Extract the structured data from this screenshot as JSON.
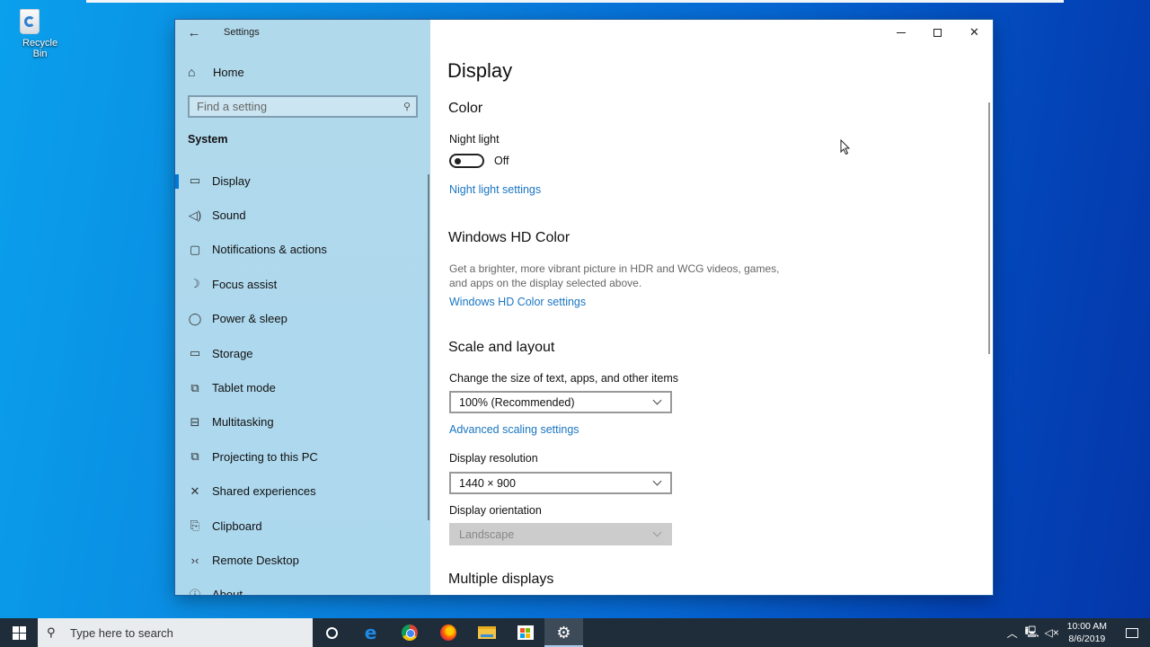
{
  "desktop": {
    "icons": [
      {
        "label": "Recycle Bin",
        "icon": "recycle-bin-icon"
      }
    ]
  },
  "window": {
    "title": "Settings",
    "controls": {
      "minimize": "minimize",
      "maximize": "maximize",
      "close": "close"
    }
  },
  "sidebar": {
    "home_label": "Home",
    "search_placeholder": "Find a setting",
    "section_label": "System",
    "items": [
      {
        "label": "Display",
        "icon": "monitor-icon",
        "glyph": "▭",
        "active": true
      },
      {
        "label": "Sound",
        "icon": "speaker-icon",
        "glyph": "🔈"
      },
      {
        "label": "Notifications & actions",
        "icon": "notification-icon",
        "glyph": "▢"
      },
      {
        "label": "Focus assist",
        "icon": "moon-icon",
        "glyph": "☽"
      },
      {
        "label": "Power & sleep",
        "icon": "power-icon",
        "glyph": "⏻"
      },
      {
        "label": "Storage",
        "icon": "storage-icon",
        "glyph": "▭"
      },
      {
        "label": "Tablet mode",
        "icon": "tablet-mode-icon",
        "glyph": "⧉"
      },
      {
        "label": "Multitasking",
        "icon": "multitasking-icon",
        "glyph": "⊟"
      },
      {
        "label": "Projecting to this PC",
        "icon": "projecting-icon",
        "glyph": "⧉"
      },
      {
        "label": "Shared experiences",
        "icon": "shared-experiences-icon",
        "glyph": "✕"
      },
      {
        "label": "Clipboard",
        "icon": "clipboard-icon",
        "glyph": "📋"
      },
      {
        "label": "Remote Desktop",
        "icon": "remote-desktop-icon",
        "glyph": "›‹"
      },
      {
        "label": "About",
        "icon": "info-icon",
        "glyph": "ⓘ"
      }
    ]
  },
  "main": {
    "page_title": "Display",
    "color": {
      "heading": "Color",
      "night_light_label": "Night light",
      "night_light_state": "Off",
      "night_light_on": false,
      "night_light_link": "Night light settings"
    },
    "hd_color": {
      "heading": "Windows HD Color",
      "description": "Get a brighter, more vibrant picture in HDR and WCG videos, games, and apps on the display selected above.",
      "link": "Windows HD Color settings"
    },
    "scale_layout": {
      "heading": "Scale and layout",
      "scale_label": "Change the size of text, apps, and other items",
      "scale_value": "100% (Recommended)",
      "advanced_link": "Advanced scaling settings",
      "resolution_label": "Display resolution",
      "resolution_value": "1440 × 900",
      "orientation_label": "Display orientation",
      "orientation_value": "Landscape",
      "orientation_disabled": true
    },
    "multiple_displays": {
      "heading": "Multiple displays"
    }
  },
  "taskbar": {
    "search_placeholder": "Type here to search",
    "apps": [
      {
        "name": "Cortana",
        "icon": "cortana-icon"
      },
      {
        "name": "Microsoft Edge",
        "icon": "edge-icon"
      },
      {
        "name": "Google Chrome",
        "icon": "chrome-icon"
      },
      {
        "name": "Firefox",
        "icon": "firefox-icon"
      },
      {
        "name": "File Explorer",
        "icon": "file-explorer-icon"
      },
      {
        "name": "Microsoft Store",
        "icon": "store-icon"
      },
      {
        "name": "Settings",
        "icon": "settings-gear-icon",
        "active": true
      }
    ],
    "tray": {
      "time": "10:00 AM",
      "date": "8/6/2019",
      "volume_muted": true
    }
  },
  "colors": {
    "accent": "#0078d7",
    "link": "#1a76c2",
    "sidebar_bg": "#b1d9ec",
    "taskbar_bg": "#1f2c3a"
  }
}
